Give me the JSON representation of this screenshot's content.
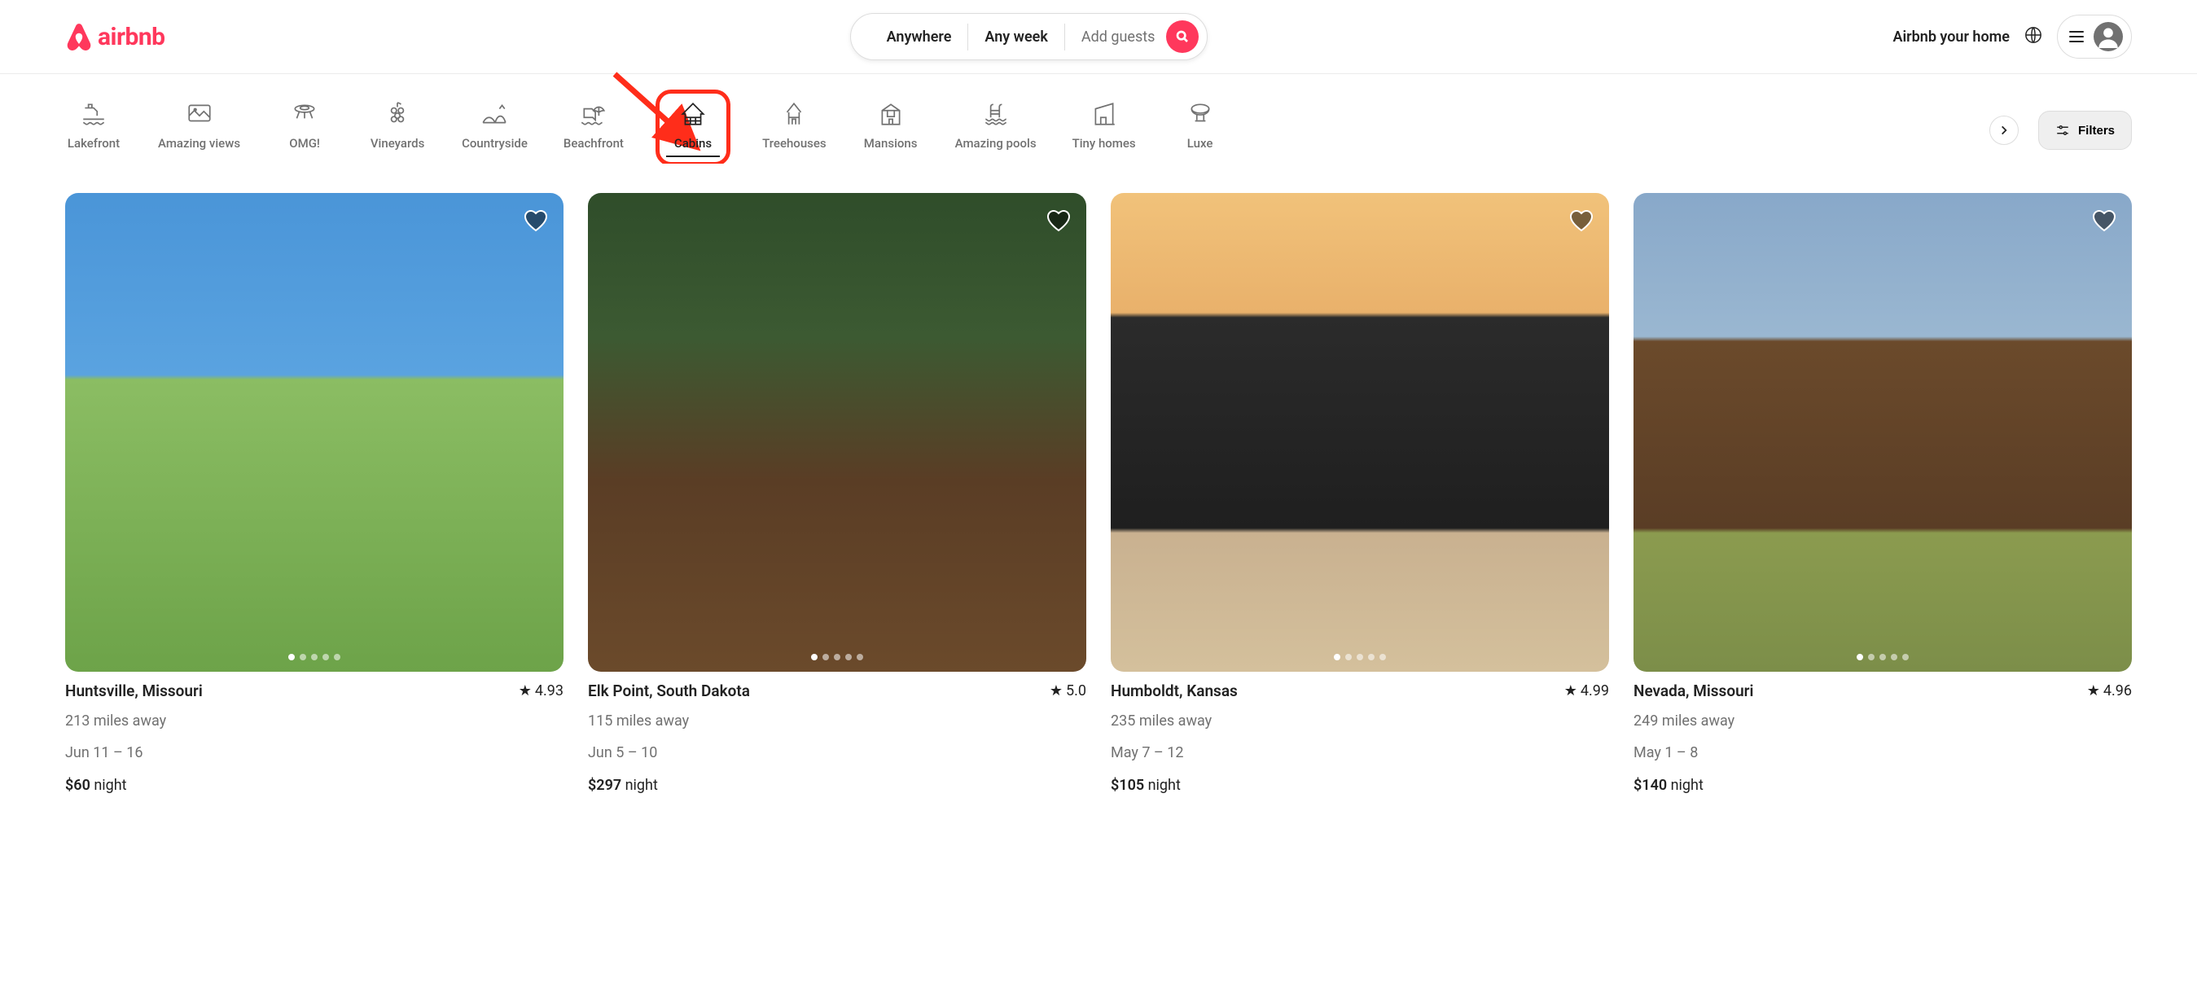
{
  "brand": {
    "name": "airbnb"
  },
  "search": {
    "where": "Anywhere",
    "when": "Any week",
    "who_placeholder": "Add guests"
  },
  "header": {
    "host_link": "Airbnb your home"
  },
  "categories": {
    "items": [
      {
        "key": "lakefront",
        "label": "Lakefront"
      },
      {
        "key": "amazing-views",
        "label": "Amazing views"
      },
      {
        "key": "omg",
        "label": "OMG!"
      },
      {
        "key": "vineyards",
        "label": "Vineyards"
      },
      {
        "key": "countryside",
        "label": "Countryside"
      },
      {
        "key": "beachfront",
        "label": "Beachfront"
      },
      {
        "key": "cabins",
        "label": "Cabins",
        "active": true,
        "highlighted": true
      },
      {
        "key": "treehouses",
        "label": "Treehouses"
      },
      {
        "key": "mansions",
        "label": "Mansions"
      },
      {
        "key": "amazing-pools",
        "label": "Amazing pools"
      },
      {
        "key": "tiny-homes",
        "label": "Tiny homes"
      },
      {
        "key": "luxe",
        "label": "Luxe"
      }
    ],
    "filters_label": "Filters"
  },
  "listings": [
    {
      "location": "Huntsville, Missouri",
      "rating": "4.93",
      "distance": "213 miles away",
      "dates": "Jun 11 – 16",
      "price": "$60",
      "price_unit": "night"
    },
    {
      "location": "Elk Point, South Dakota",
      "rating": "5.0",
      "distance": "115 miles away",
      "dates": "Jun 5 – 10",
      "price": "$297",
      "price_unit": "night"
    },
    {
      "location": "Humboldt, Kansas",
      "rating": "4.99",
      "distance": "235 miles away",
      "dates": "May 7 – 12",
      "price": "$105",
      "price_unit": "night"
    },
    {
      "location": "Nevada, Missouri",
      "rating": "4.96",
      "distance": "249 miles away",
      "dates": "May 1 – 8",
      "price": "$140",
      "price_unit": "night"
    }
  ],
  "annotation": {
    "target_category": "cabins"
  }
}
